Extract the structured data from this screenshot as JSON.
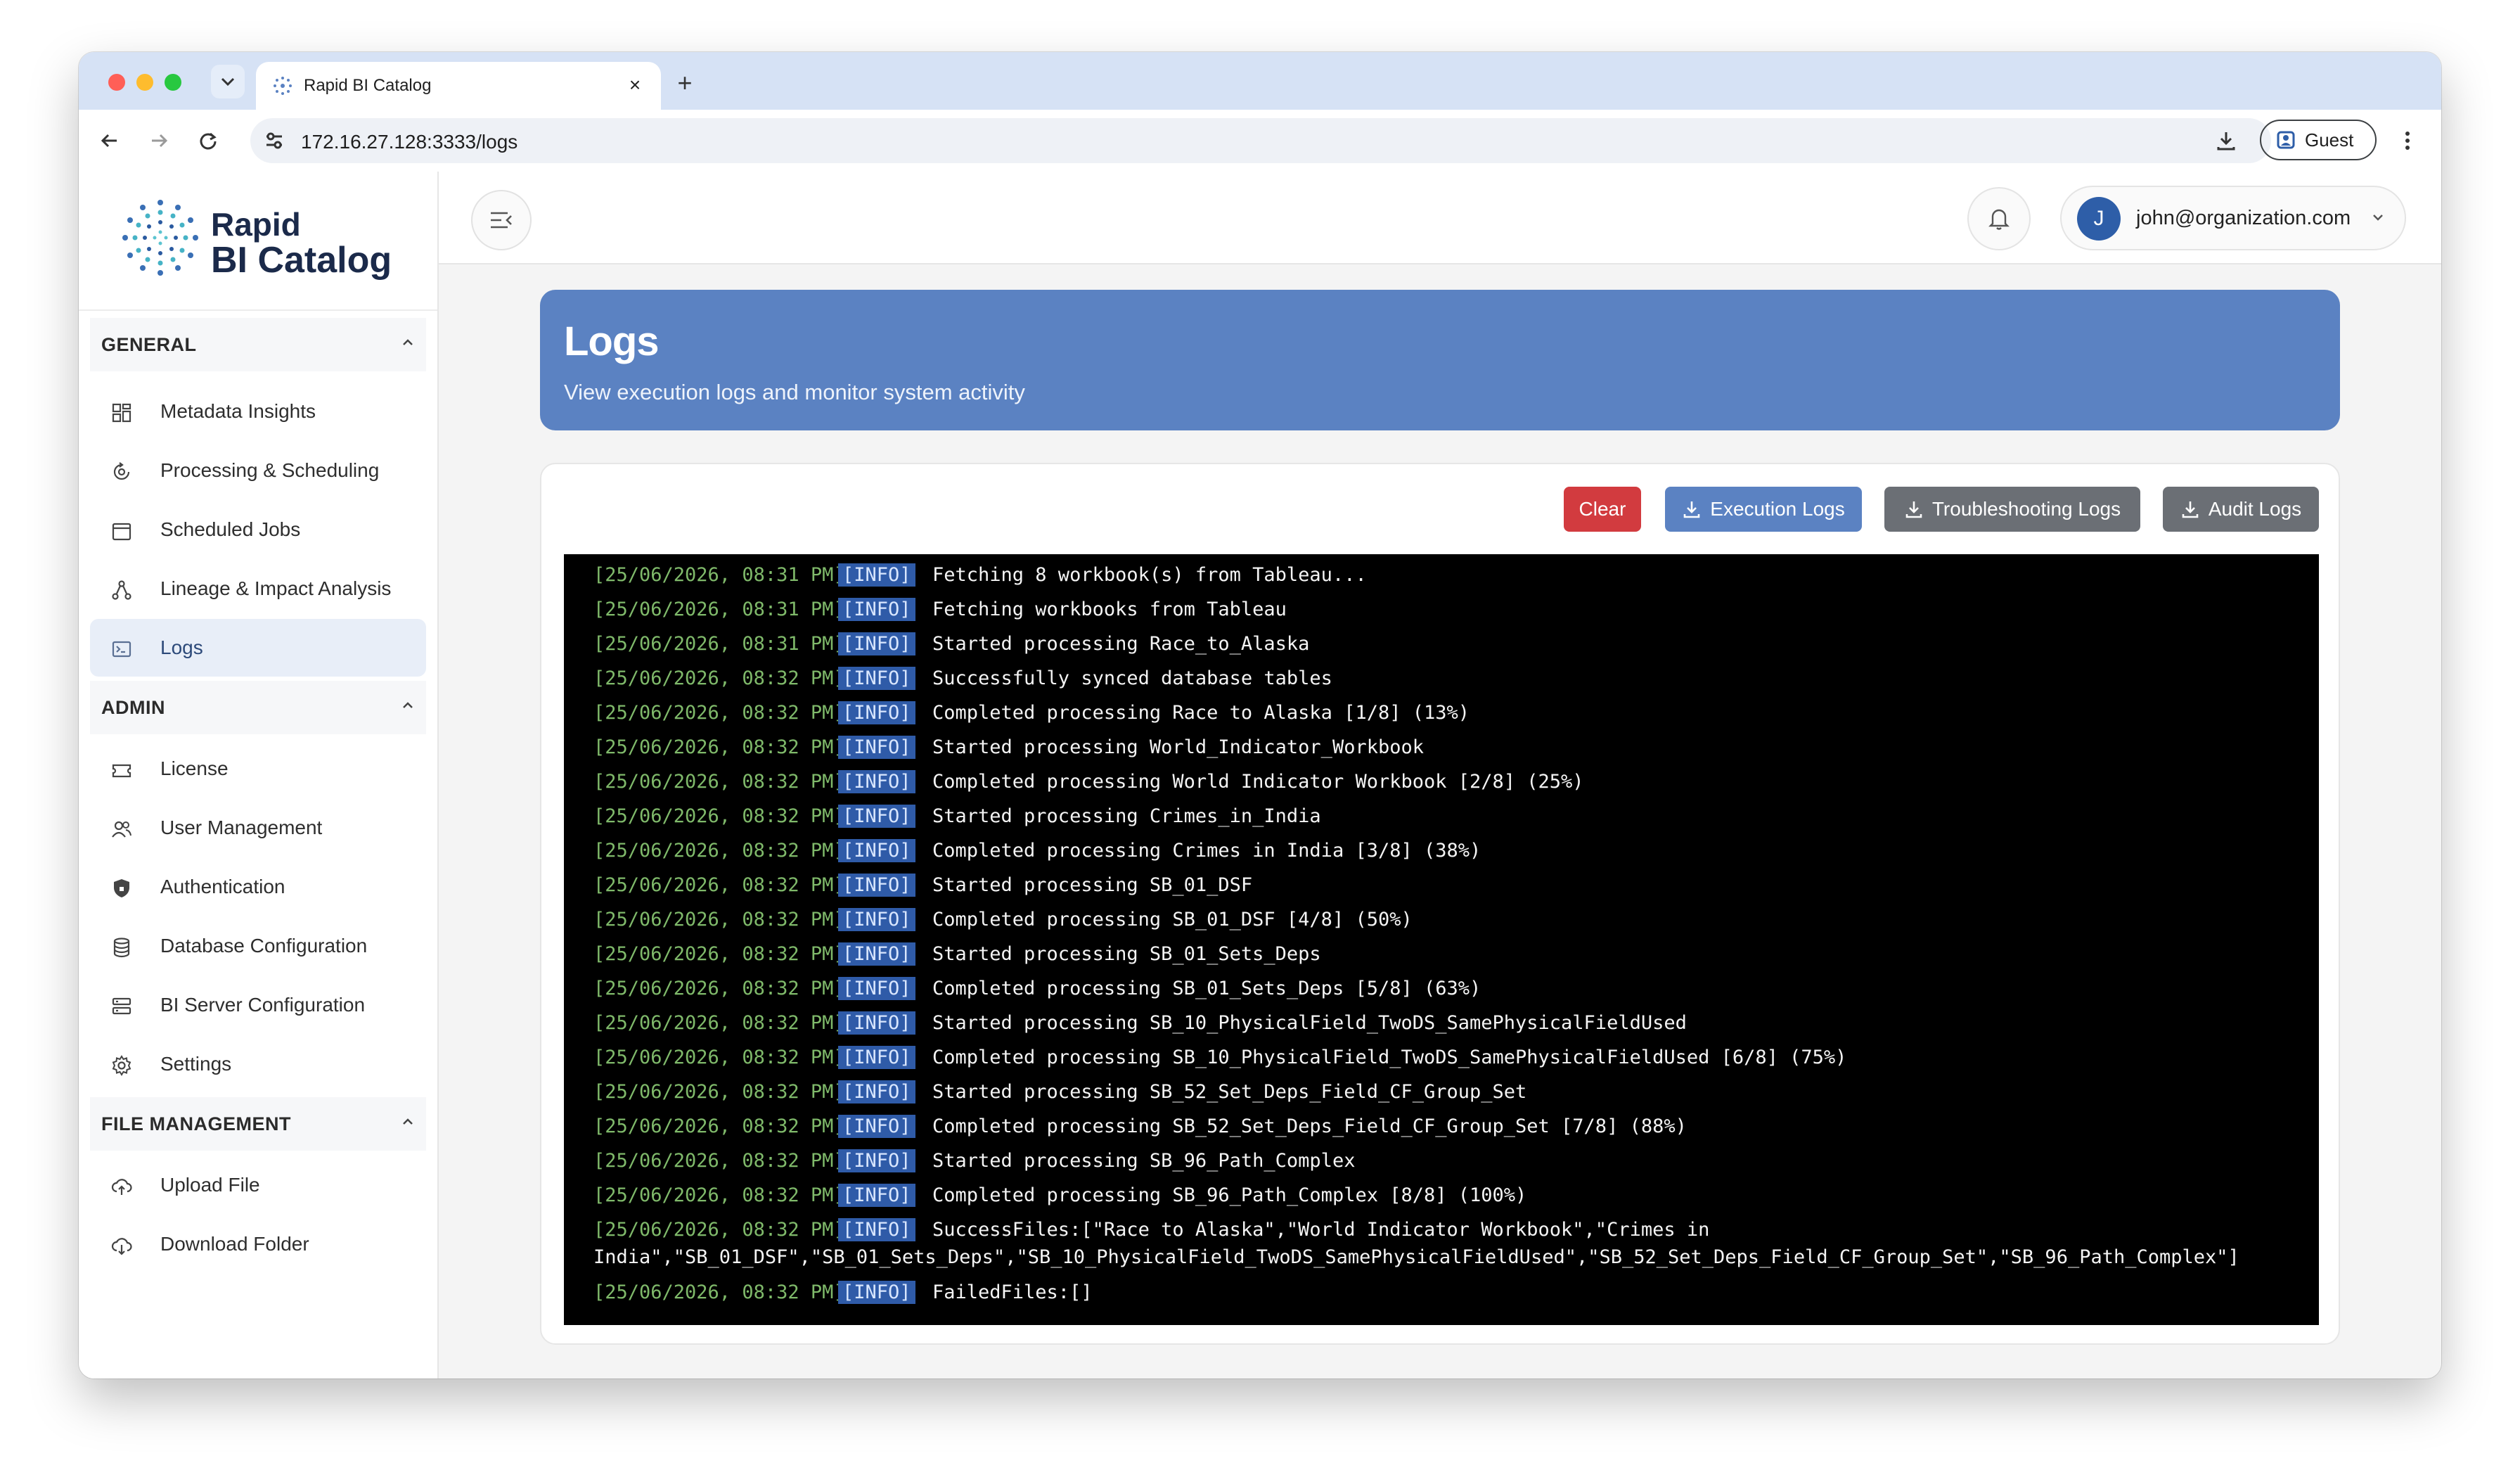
{
  "browser": {
    "tab_title": "Rapid BI Catalog",
    "url": "172.16.27.128:3333/logs",
    "profile_label": "Guest",
    "icons": [
      "tab-list-icon",
      "close-icon",
      "new-tab-icon",
      "back-icon",
      "forward-icon",
      "reload-icon",
      "site-settings-icon",
      "download-icon",
      "profile-icon",
      "menu-kebab-icon"
    ]
  },
  "sidebar": {
    "logo_line1": "Rapid",
    "logo_line2": "BI Catalog",
    "sections": [
      {
        "title": "GENERAL",
        "items": [
          {
            "label": "Metadata Insights",
            "icon": "dashboard-grid-icon"
          },
          {
            "label": "Processing & Scheduling",
            "icon": "processing-cycle-icon"
          },
          {
            "label": "Scheduled Jobs",
            "icon": "calendar-icon"
          },
          {
            "label": "Lineage & Impact Analysis",
            "icon": "lineage-tree-icon"
          },
          {
            "label": "Logs",
            "icon": "terminal-icon",
            "active": true
          }
        ]
      },
      {
        "title": "ADMIN",
        "items": [
          {
            "label": "License",
            "icon": "license-ticket-icon"
          },
          {
            "label": "User Management",
            "icon": "users-icon"
          },
          {
            "label": "Authentication",
            "icon": "shield-icon"
          },
          {
            "label": "Database Configuration",
            "icon": "database-icon"
          },
          {
            "label": "BI Server Configuration",
            "icon": "server-icon"
          },
          {
            "label": "Settings",
            "icon": "gear-icon"
          }
        ]
      },
      {
        "title": "FILE MANAGEMENT",
        "items": [
          {
            "label": "Upload File",
            "icon": "cloud-upload-icon"
          },
          {
            "label": "Download Folder",
            "icon": "cloud-download-icon"
          }
        ]
      }
    ]
  },
  "topbar": {
    "user_initial": "J",
    "user_email": "john@organization.com"
  },
  "page": {
    "title": "Logs",
    "subtitle": "View execution logs and monitor system activity"
  },
  "actions": {
    "clear": "Clear",
    "execution_logs": "Execution Logs",
    "troubleshooting_logs": "Troubleshooting Logs",
    "audit_logs": "Audit Logs"
  },
  "colors": {
    "accent": "#5b82c2",
    "danger": "#d23b3f",
    "neutral_button": "#6b6f75",
    "console_bg": "#000000",
    "timestamp": "#7fb96a",
    "level_badge": "#2f5ba8"
  },
  "logs": [
    {
      "ts": "[25/06/2026, 08:31 PM]",
      "level": "[INFO]",
      "msg": "Fetching 8 workbook(s) from Tableau..."
    },
    {
      "ts": "[25/06/2026, 08:31 PM]",
      "level": "[INFO]",
      "msg": "Fetching workbooks from Tableau"
    },
    {
      "ts": "[25/06/2026, 08:31 PM]",
      "level": "[INFO]",
      "msg": "Started processing Race_to_Alaska"
    },
    {
      "ts": "[25/06/2026, 08:32 PM]",
      "level": "[INFO]",
      "msg": "Successfully synced database tables"
    },
    {
      "ts": "[25/06/2026, 08:32 PM]",
      "level": "[INFO]",
      "msg": "Completed processing Race to Alaska [1/8] (13%)"
    },
    {
      "ts": "[25/06/2026, 08:32 PM]",
      "level": "[INFO]",
      "msg": "Started processing World_Indicator_Workbook"
    },
    {
      "ts": "[25/06/2026, 08:32 PM]",
      "level": "[INFO]",
      "msg": "Completed processing World Indicator Workbook [2/8] (25%)"
    },
    {
      "ts": "[25/06/2026, 08:32 PM]",
      "level": "[INFO]",
      "msg": "Started processing Crimes_in_India"
    },
    {
      "ts": "[25/06/2026, 08:32 PM]",
      "level": "[INFO]",
      "msg": "Completed processing Crimes in India [3/8] (38%)"
    },
    {
      "ts": "[25/06/2026, 08:32 PM]",
      "level": "[INFO]",
      "msg": "Started processing SB_01_DSF"
    },
    {
      "ts": "[25/06/2026, 08:32 PM]",
      "level": "[INFO]",
      "msg": "Completed processing SB_01_DSF [4/8] (50%)"
    },
    {
      "ts": "[25/06/2026, 08:32 PM]",
      "level": "[INFO]",
      "msg": "Started processing SB_01_Sets_Deps"
    },
    {
      "ts": "[25/06/2026, 08:32 PM]",
      "level": "[INFO]",
      "msg": "Completed processing SB_01_Sets_Deps [5/8] (63%)"
    },
    {
      "ts": "[25/06/2026, 08:32 PM]",
      "level": "[INFO]",
      "msg": "Started processing SB_10_PhysicalField_TwoDS_SamePhysicalFieldUsed"
    },
    {
      "ts": "[25/06/2026, 08:32 PM]",
      "level": "[INFO]",
      "msg": "Completed processing SB_10_PhysicalField_TwoDS_SamePhysicalFieldUsed [6/8] (75%)"
    },
    {
      "ts": "[25/06/2026, 08:32 PM]",
      "level": "[INFO]",
      "msg": "Started processing SB_52_Set_Deps_Field_CF_Group_Set"
    },
    {
      "ts": "[25/06/2026, 08:32 PM]",
      "level": "[INFO]",
      "msg": "Completed processing SB_52_Set_Deps_Field_CF_Group_Set [7/8] (88%)"
    },
    {
      "ts": "[25/06/2026, 08:32 PM]",
      "level": "[INFO]",
      "msg": "Started processing SB_96_Path_Complex"
    },
    {
      "ts": "[25/06/2026, 08:32 PM]",
      "level": "[INFO]",
      "msg": "Completed processing SB_96_Path_Complex [8/8] (100%)"
    },
    {
      "ts": "[25/06/2026, 08:32 PM]",
      "level": "[INFO]",
      "msg": "SuccessFiles:[\"Race to Alaska\",\"World Indicator Workbook\",\"Crimes in",
      "msg_cont": "India\",\"SB_01_DSF\",\"SB_01_Sets_Deps\",\"SB_10_PhysicalField_TwoDS_SamePhysicalFieldUsed\",\"SB_52_Set_Deps_Field_CF_Group_Set\",\"SB_96_Path_Complex\"]"
    },
    {
      "ts": "[25/06/2026, 08:32 PM]",
      "level": "[INFO]",
      "msg": "FailedFiles:[]"
    }
  ]
}
